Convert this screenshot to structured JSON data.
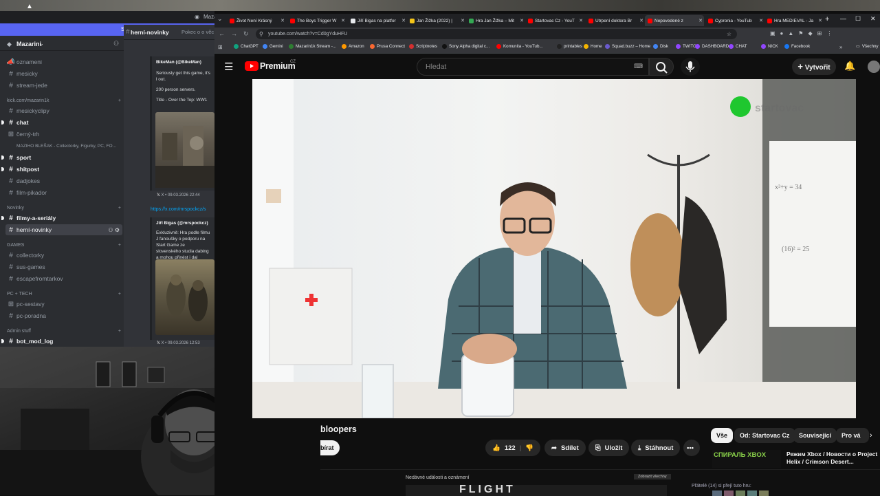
{
  "discord": {
    "window_title": "Mazar",
    "stream_banner": "Streamovací režim je povolen. Uživat",
    "server_name": "Mazarini",
    "channels_top": [
      "oznameni",
      "mesicky",
      "stream-jede"
    ],
    "category_kick": "kick.com/mazarin1k",
    "channels_kick": [
      "mesickyclipy",
      "chat",
      "černý-trh"
    ],
    "forum_item": "MAZIHO BLEŠAK - Collectorky, Figurky, PC, FO...",
    "channels_kick2": [
      "sport",
      "shitpost",
      "dadjokes",
      "film-pikador"
    ],
    "category_novinky": "Novinky",
    "channels_novinky": [
      "filmy-a-seriály",
      "herní-novinky"
    ],
    "category_games": "GAMES",
    "channels_games": [
      "collectorky",
      "sus-games",
      "escapefromtarkov"
    ],
    "category_pc": "PC + TECH",
    "channels_pc": [
      "pc-sestavy",
      "pc-poradna"
    ],
    "category_admin": "Admin stuff",
    "channels_admin": [
      "bot_mod_log"
    ],
    "chat_header": "herní-novinky",
    "chat_topic": "Pokec o o věc",
    "embed1_author": "BikeMan (@BikeMan)",
    "embed1_text": "Seriously get this game, it's l out.",
    "embed1_line2": "200 person servers.",
    "embed1_line3": "Title - Over the Top: WW1",
    "embed1_footer": "X • 09.03.2026 22:44",
    "link": "https://x.com/mrspockcz/s",
    "embed2_author": "Jiří Bigas (@mrspockcz)",
    "embed2_text": "Exkluzivně: Hra podle filmu J fanoušky o podporu na Start Game ze slovenského studia dabing a mohou přinést i dal",
    "embed2_footer": "X • 09.03.2026 12:53"
  },
  "browser": {
    "tabs": [
      {
        "label": "Život Není Krásný",
        "color": "#ff0000"
      },
      {
        "label": "The Boys Trigger W",
        "color": "#ff0000"
      },
      {
        "label": "Jiří Bigas na platfor",
        "color": "#e8eaed"
      },
      {
        "label": "Jan Žižka (2022) | ",
        "color": "#f5c518"
      },
      {
        "label": "Hra Jan Žižka – Mit",
        "color": "#34a853"
      },
      {
        "label": "Startovac Cz - YouT",
        "color": "#ff0000"
      },
      {
        "label": "Utrpení doktora Br",
        "color": "#ff0000"
      },
      {
        "label": "Nepovedené z",
        "color": "#ff0000"
      },
      {
        "label": "Cypronia - YouTub",
        "color": "#ff0000"
      },
      {
        "label": "Hra MEDIEVAL - Ja",
        "color": "#ff0000"
      }
    ],
    "url": "youtube.com/watch?v=Cd0gYduHFU",
    "bookmarks": [
      "ChatGPT",
      "Gemini",
      "Mazarin1k Stream -...",
      "Amazon",
      "Prusa Connect",
      "Scriptnotes",
      "Sony Alpha digital c...",
      "Komunita - YouTub...",
      "printables",
      "Home",
      "Squad.buzz – Home",
      "Disk",
      "TWITCH",
      "DASHBOARD",
      "CHAT",
      "NICK",
      "Facebook"
    ],
    "bookmarks_folder": "Všechny"
  },
  "youtube": {
    "logo_text": "Premium",
    "logo_region": "CZ",
    "search_placeholder": "Hledat",
    "create_label": "Vytvořit",
    "video_title": "bloopers",
    "subscribe_fragment": "bírat",
    "like_count": "122",
    "share_label": "Sdílet",
    "save_label": "Uložit",
    "download_label": "Stáhnout",
    "chips": [
      "Vše",
      "Od: Startovac Cz",
      "Související",
      "Pro vá"
    ],
    "recommended_channel_text": "СПИРАЛЬ XBOX",
    "recommended_title": "Режим Xbox / Новости о Project Helix / Crimson Desert...",
    "bottom_heading": "Nedávné události a oznámení",
    "bottom_button": "Zobrazit všechny",
    "friends_text": "Přátelé (14) si přejí tuto hru:",
    "bottom_game_title": "FLIGHT",
    "video_watermark": "startovac"
  }
}
